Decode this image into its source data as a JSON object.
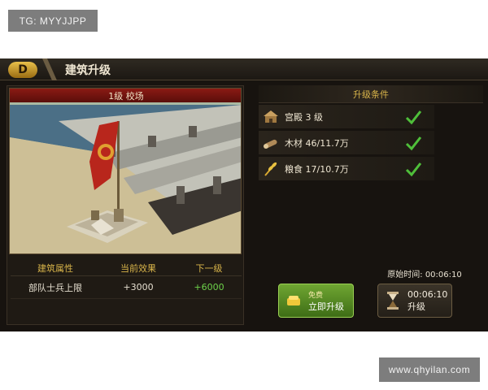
{
  "watermark_top": "TG: MYYJJPP",
  "watermark_bottom": "www.qhyilan.com",
  "header": {
    "back_icon": "D",
    "title": "建筑升级"
  },
  "building": {
    "banner": "1级 校场"
  },
  "attributes": {
    "headers": [
      "建筑属性",
      "当前效果",
      "下一级"
    ],
    "rows": [
      {
        "name": "部队士兵上限",
        "current": "+3000",
        "next": "+6000"
      }
    ]
  },
  "requirements": {
    "title": "升级条件",
    "items": [
      {
        "icon": "palace-icon",
        "text": "宫殿 3 级",
        "met": true
      },
      {
        "icon": "wood-icon",
        "text": "木材 46/11.7万",
        "met": true
      },
      {
        "icon": "grain-icon",
        "text": "粮食 17/10.7万",
        "met": true
      }
    ]
  },
  "actions": {
    "original_time": "原始时间: 00:06:10",
    "free_small": "免费",
    "free_label": "立即升级",
    "timed_time": "00:06:10",
    "timed_label": "升级"
  },
  "colors": {
    "accent_gold": "#d8b44a",
    "check_green": "#4fbf3a",
    "next_value_green": "#6dd24a",
    "banner_red": "#8a1a14"
  }
}
